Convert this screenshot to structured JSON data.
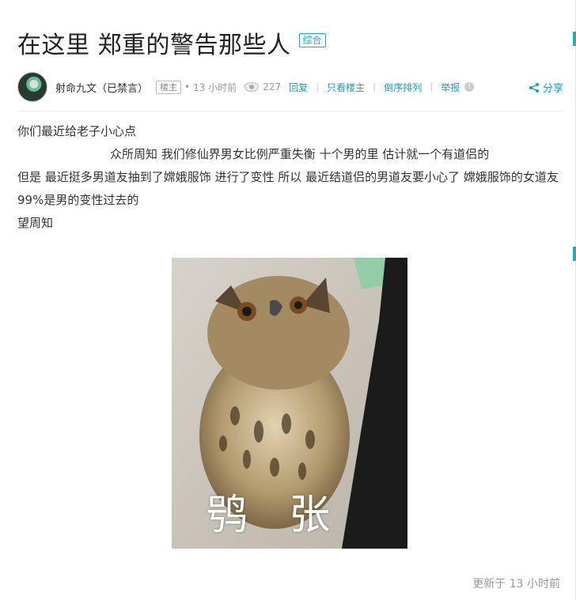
{
  "post": {
    "title": "在这里 郑重的警告那些人",
    "category": "综合",
    "author": "射命九文（已禁言）",
    "role": "楼主",
    "time": "13 小时前",
    "views": "227",
    "actions": {
      "reply": "回复",
      "only_op": "只看楼主",
      "reverse": "倒序排列",
      "report": "举报"
    },
    "share": "分享",
    "body": [
      "你们最近给老子小心点",
      "众所周知  我们修仙界男女比例严重失衡  十个男的里  估计就一个有道侣的",
      "但是  最近挺多男道友抽到了嫦娥服饰  进行了变性   所以   最近结道侣的男道友要小心了   嫦娥服饰的女道友   99%是男的变性过去的",
      "望周知"
    ],
    "image_caption": "鸮 张",
    "updated": "更新于  13  小时前"
  },
  "colors": {
    "accent": "#1aaeb5",
    "link": "#1a9eb7"
  },
  "icons": {
    "views": "eye-icon",
    "share": "share-icon",
    "report": "warning-icon"
  }
}
